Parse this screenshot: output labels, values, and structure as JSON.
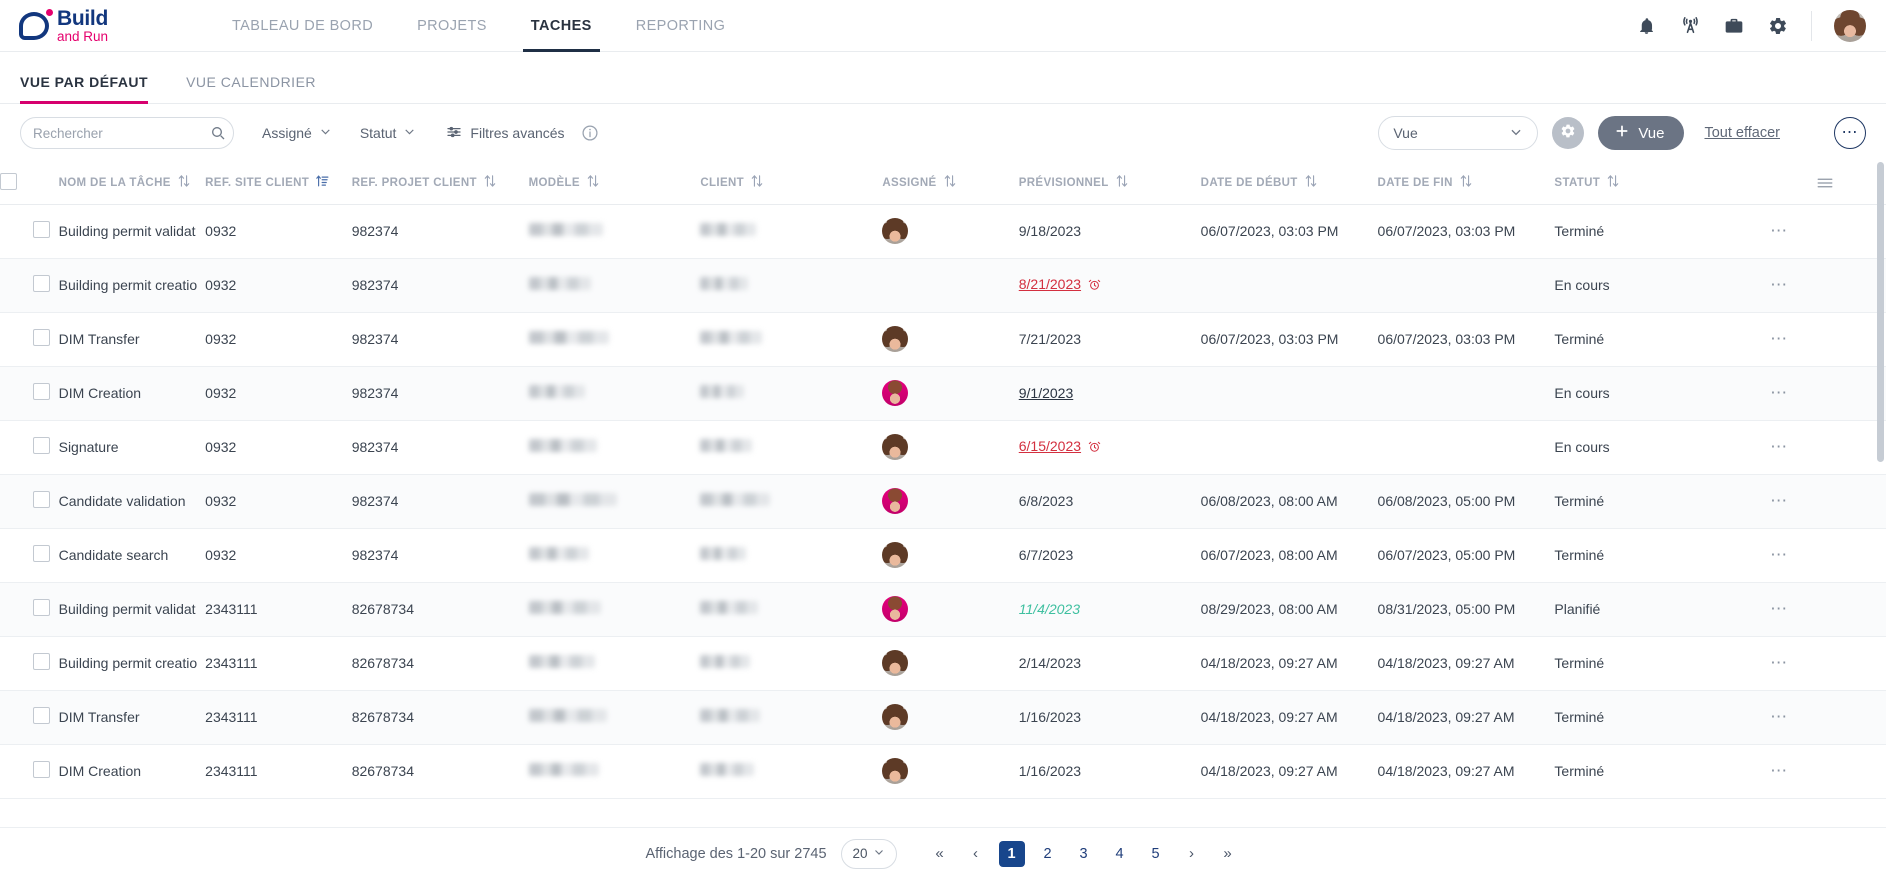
{
  "brand": {
    "name_top": "Build",
    "name_bottom": "and Run"
  },
  "topnav": {
    "items": [
      {
        "label": "TABLEAU DE BORD",
        "active": false
      },
      {
        "label": "PROJETS",
        "active": false
      },
      {
        "label": "TACHES",
        "active": true
      },
      {
        "label": "REPORTING",
        "active": false
      }
    ],
    "icons": [
      "bell-icon",
      "broadcast-icon",
      "briefcase-icon",
      "gear-icon"
    ]
  },
  "viewtabs": [
    {
      "label": "VUE PAR DÉFAUT",
      "active": true
    },
    {
      "label": "VUE CALENDRIER",
      "active": false
    }
  ],
  "filterbar": {
    "search_placeholder": "Rechercher",
    "search_value": "",
    "assigned_label": "Assigné",
    "status_label": "Statut",
    "advanced_filters_label": "Filtres avancés",
    "view_select_value": "Vue",
    "add_view_label": "Vue",
    "clear_all_label": "Tout effacer"
  },
  "table": {
    "headers": [
      {
        "label": "NOM DE LA TÂCHE",
        "sorted": false
      },
      {
        "label": "REF. SITE CLIENT",
        "sorted": true
      },
      {
        "label": "REF. PROJET CLIENT",
        "sorted": false
      },
      {
        "label": "MODÈLE",
        "sorted": false
      },
      {
        "label": "CLIENT",
        "sorted": false
      },
      {
        "label": "ASSIGNÉ",
        "sorted": false
      },
      {
        "label": "PRÉVISIONNEL",
        "sorted": false
      },
      {
        "label": "DATE DE DÉBUT",
        "sorted": false
      },
      {
        "label": "DATE DE FIN",
        "sorted": false
      },
      {
        "label": "STATUT",
        "sorted": false
      }
    ],
    "rows": [
      {
        "task": "Building permit validat",
        "site_ref": "0932",
        "project_ref": "982374",
        "model": "",
        "client": "",
        "avatar": "brown",
        "forecast": "9/18/2023",
        "forecast_style": "normal",
        "start": "06/07/2023, 03:03 PM",
        "end": "06/07/2023, 03:03 PM",
        "status": "Terminé"
      },
      {
        "task": "Building permit creatio",
        "site_ref": "0932",
        "project_ref": "982374",
        "model": "",
        "client": "",
        "avatar": "none",
        "forecast": "8/21/2023",
        "forecast_style": "late",
        "start": "",
        "end": "",
        "status": "En cours"
      },
      {
        "task": "DIM Transfer",
        "site_ref": "0932",
        "project_ref": "982374",
        "model": "",
        "client": "",
        "avatar": "brown",
        "forecast": "7/21/2023",
        "forecast_style": "normal",
        "start": "06/07/2023, 03:03 PM",
        "end": "06/07/2023, 03:03 PM",
        "status": "Terminé"
      },
      {
        "task": "DIM Creation",
        "site_ref": "0932",
        "project_ref": "982374",
        "model": "",
        "client": "",
        "avatar": "pink",
        "forecast": "9/1/2023",
        "forecast_style": "link",
        "start": "",
        "end": "",
        "status": "En cours"
      },
      {
        "task": "Signature",
        "site_ref": "0932",
        "project_ref": "982374",
        "model": "",
        "client": "",
        "avatar": "brown",
        "forecast": "6/15/2023",
        "forecast_style": "late",
        "start": "",
        "end": "",
        "status": "En cours"
      },
      {
        "task": "Candidate validation",
        "site_ref": "0932",
        "project_ref": "982374",
        "model": "",
        "client": "",
        "avatar": "pink",
        "forecast": "6/8/2023",
        "forecast_style": "normal",
        "start": "06/08/2023, 08:00 AM",
        "end": "06/08/2023, 05:00 PM",
        "status": "Terminé"
      },
      {
        "task": "Candidate search",
        "site_ref": "0932",
        "project_ref": "982374",
        "model": "",
        "client": "",
        "avatar": "brown",
        "forecast": "6/7/2023",
        "forecast_style": "normal",
        "start": "06/07/2023, 08:00 AM",
        "end": "06/07/2023, 05:00 PM",
        "status": "Terminé"
      },
      {
        "task": "Building permit validat",
        "site_ref": "2343111",
        "project_ref": "82678734",
        "model": "",
        "client": "",
        "avatar": "pink",
        "forecast": "11/4/2023",
        "forecast_style": "planned",
        "start": "08/29/2023, 08:00 AM",
        "end": "08/31/2023, 05:00 PM",
        "status": "Planifié"
      },
      {
        "task": "Building permit creatio",
        "site_ref": "2343111",
        "project_ref": "82678734",
        "model": "",
        "client": "",
        "avatar": "brown",
        "forecast": "2/14/2023",
        "forecast_style": "normal",
        "start": "04/18/2023, 09:27 AM",
        "end": "04/18/2023, 09:27 AM",
        "status": "Terminé"
      },
      {
        "task": "DIM Transfer",
        "site_ref": "2343111",
        "project_ref": "82678734",
        "model": "",
        "client": "",
        "avatar": "brown",
        "forecast": "1/16/2023",
        "forecast_style": "normal",
        "start": "04/18/2023, 09:27 AM",
        "end": "04/18/2023, 09:27 AM",
        "status": "Terminé"
      },
      {
        "task": "DIM Creation",
        "site_ref": "2343111",
        "project_ref": "82678734",
        "model": "",
        "client": "",
        "avatar": "brown",
        "forecast": "1/16/2023",
        "forecast_style": "normal",
        "start": "04/18/2023, 09:27 AM",
        "end": "04/18/2023, 09:27 AM",
        "status": "Terminé"
      }
    ]
  },
  "pagination": {
    "summary": "Affichage des 1-20 sur 2745",
    "page_size": "20",
    "pages": [
      "1",
      "2",
      "3",
      "4",
      "5"
    ],
    "current_page": "1"
  },
  "colors": {
    "accent_pink": "#d6006e",
    "brand_blue": "#12377e",
    "page_active_blue": "#18468c",
    "late_red": "#d32f3f",
    "planned_green": "#3fc0a0"
  }
}
